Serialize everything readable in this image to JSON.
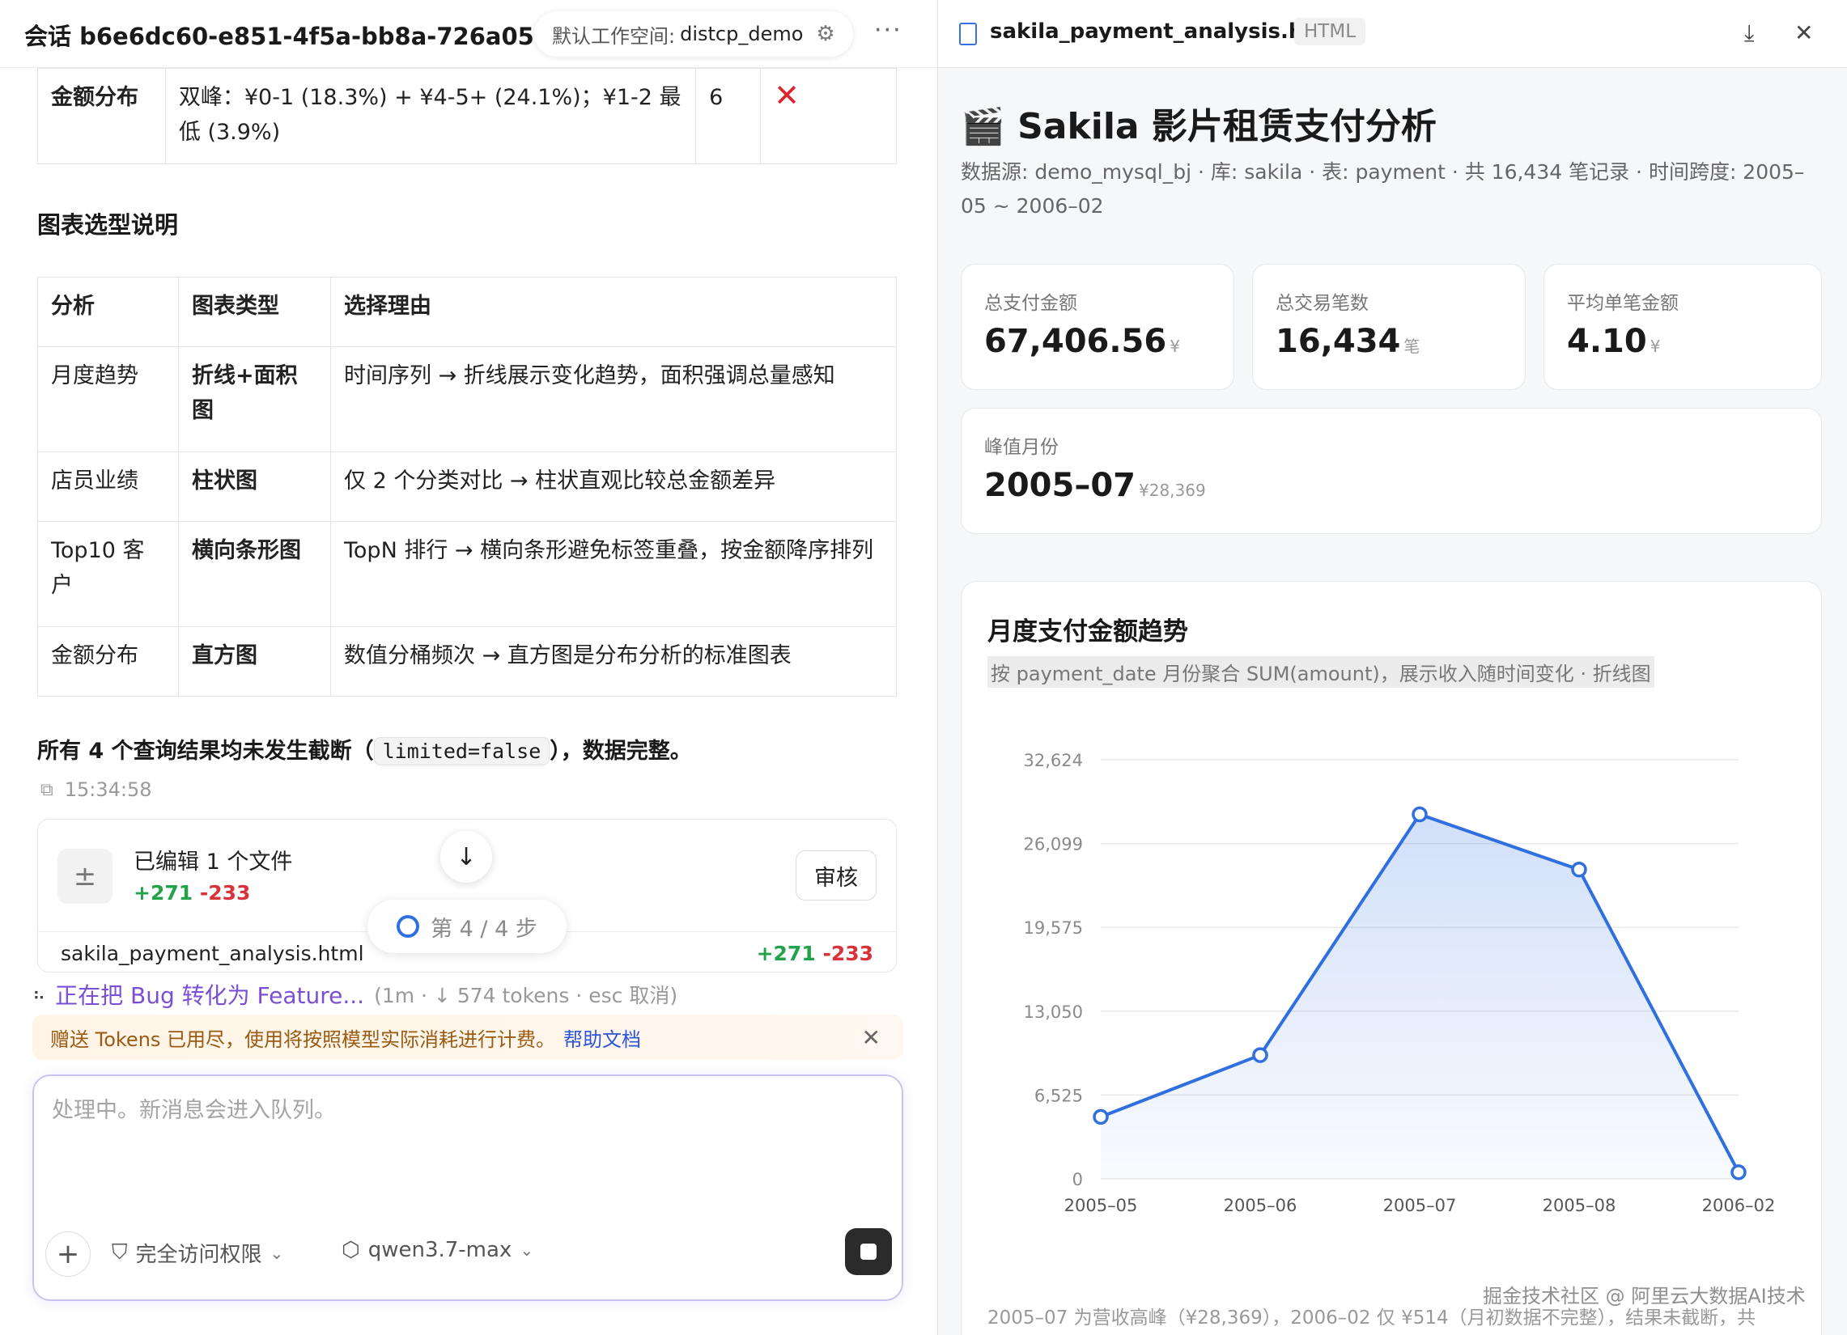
{
  "header": {
    "session_title": "会话 b6e6dc60-e851-4f5a-bb8a-726a051...",
    "workspace_label": "默认工作空间:",
    "workspace_name": "distcp_demo"
  },
  "prev_table_row": {
    "col1": "金额分布",
    "col2": "双峰：¥0-1 (18.3%) + ¥4-5+ (24.1%)；¥1-2 最低 (3.9%)",
    "col3": "6",
    "col4": "✕"
  },
  "chart_selection": {
    "heading": "图表选型说明",
    "headers": [
      "分析",
      "图表类型",
      "选择理由"
    ],
    "rows": [
      [
        "月度趋势",
        "折线+面积图",
        "时间序列 → 折线展示变化趋势，面积强调总量感知"
      ],
      [
        "店员业绩",
        "柱状图",
        "仅 2 个分类对比 → 柱状直观比较总金额差异"
      ],
      [
        "Top10 客户",
        "横向条形图",
        "TopN 排行 → 横向条形避免标签重叠，按金额降序排列"
      ],
      [
        "金额分布",
        "直方图",
        "数值分桶频次 → 直方图是分布分析的标准图表"
      ]
    ]
  },
  "truncation_note": {
    "prefix": "所有 4 个查询结果均未发生截断（",
    "code": "limited=false",
    "suffix": "），数据完整。"
  },
  "message_time": "15:34:58",
  "edit_card": {
    "title": "已编辑 1 个文件",
    "plus": "+271",
    "minus": "-233",
    "review_label": "审核",
    "file_name": "sakila_payment_analysis.html",
    "file_plus": "+271",
    "file_minus": "-233"
  },
  "step_indicator": "第 4 / 4 步",
  "status": {
    "text": "正在把 Bug 转化为 Feature...",
    "meta": "(1m · ↓ 574 tokens · esc 取消)"
  },
  "token_banner": {
    "text": "赠送 Tokens 已用尽，使用将按照模型实际消耗进行计费。",
    "link": "帮助文档"
  },
  "composer": {
    "placeholder": "处理中。新消息会进入队列。",
    "permission_label": "完全访问权限",
    "model_label": "qwen3.7-max"
  },
  "preview": {
    "file_name": "sakila_payment_analysis.html",
    "file_type": "HTML"
  },
  "report": {
    "title": "🎬 Sakila 影片租赁支付分析",
    "subtitle": "数据源: demo_mysql_bj · 库: sakila · 表: payment · 共 16,434 笔记录 · 时间跨度: 2005–05 ~ 2006–02",
    "kpis": [
      {
        "label": "总支付金额",
        "value": "67,406.56",
        "unit": "¥"
      },
      {
        "label": "总交易笔数",
        "value": "16,434",
        "unit": "笔"
      },
      {
        "label": "平均单笔金额",
        "value": "4.10",
        "unit": "¥"
      },
      {
        "label": "峰值月份",
        "value": "2005–07",
        "unit": "¥28,369"
      }
    ],
    "chart_title": "月度支付金额趋势",
    "chart_subtitle": "按 payment_date 月份聚合 SUM(amount)，展示收入随时间变化 · 折线图",
    "chart_footer": "2005–07 为营收高峰（¥28,369），2006–02 仅 ¥514（月初数据不完整），结果未截断，共"
  },
  "chart_data": {
    "type": "line",
    "title": "月度支付金额趋势",
    "categories": [
      "2005–05",
      "2005–06",
      "2005–07",
      "2005–08",
      "2006–02"
    ],
    "values": [
      4824,
      9632,
      28369,
      24072,
      514
    ],
    "y_ticks": [
      "0",
      "6,525",
      "13,050",
      "19,575",
      "26,099",
      "32,624"
    ],
    "ylim": [
      0,
      32624
    ],
    "grid": true,
    "area_fill": true,
    "color": "#2f6fe0"
  },
  "watermark": "掘金技术社区 @ 阿里云大数据AI技术"
}
